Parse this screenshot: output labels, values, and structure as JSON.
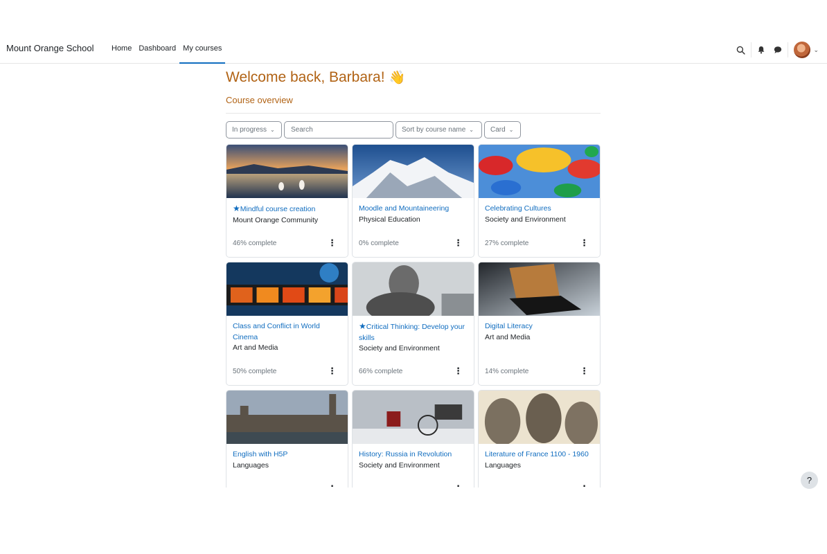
{
  "navbar": {
    "brand": "Mount Orange School",
    "links": [
      {
        "label": "Home"
      },
      {
        "label": "Dashboard"
      },
      {
        "label": "My courses"
      }
    ],
    "accent_color": "#0f6cbf"
  },
  "main": {
    "welcome": "Welcome back, Barbara!",
    "wave_emoji": "👋",
    "overview_title": "Course overview",
    "controls": {
      "filter_label": "In progress",
      "search_placeholder": "Search",
      "sort_label": "Sort by course name",
      "view_label": "Card"
    }
  },
  "courses": [
    {
      "name": "Mindful course creation",
      "category": "Mount Orange Community",
      "progress": "46% complete",
      "starred": true
    },
    {
      "name": "Moodle and Mountaineering",
      "category": "Physical Education",
      "progress": "0% complete",
      "starred": false
    },
    {
      "name": "Celebrating Cultures",
      "category": "Society and Environment",
      "progress": "27% complete",
      "starred": false
    },
    {
      "name": "Class and Conflict in World Cinema",
      "category": "Art and Media",
      "progress": "50% complete",
      "starred": false
    },
    {
      "name": "Critical Thinking: Develop your skills",
      "category": "Society and Environment",
      "progress": "66% complete",
      "starred": true
    },
    {
      "name": "Digital Literacy",
      "category": "Art and Media",
      "progress": "14% complete",
      "starred": false
    },
    {
      "name": "English with H5P",
      "category": "Languages",
      "progress": "",
      "starred": false
    },
    {
      "name": "History: Russia in Revolution",
      "category": "Society and Environment",
      "progress": "",
      "starred": false
    },
    {
      "name": "Literature of France 1100 - 1960",
      "category": "Languages",
      "progress": "",
      "starred": false
    }
  ],
  "help": {
    "label": "?"
  },
  "colors": {
    "heading": "#b16315",
    "link": "#0f6cbf"
  }
}
